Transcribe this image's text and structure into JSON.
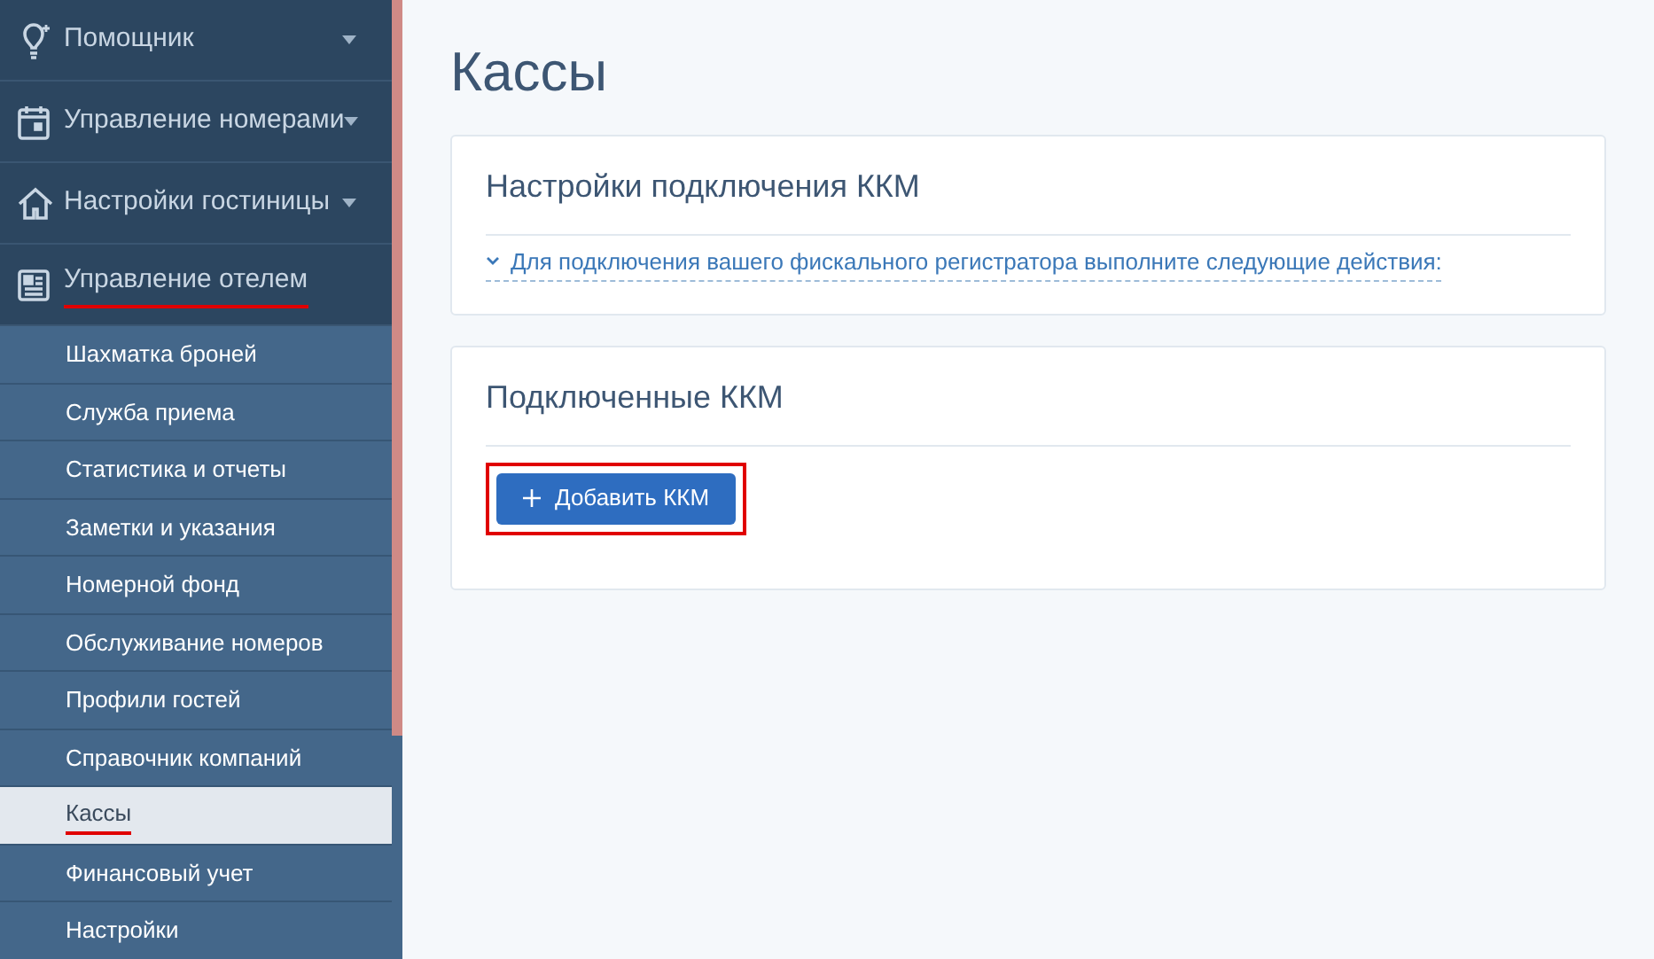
{
  "sidebar": {
    "sections": [
      {
        "label": "Помощник",
        "expanded": false,
        "highlighted": false
      },
      {
        "label": "Управление номерами",
        "expanded": false,
        "highlighted": false
      },
      {
        "label": "Настройки гостиницы",
        "expanded": false,
        "highlighted": false
      },
      {
        "label": "Управление отелем",
        "expanded": true,
        "highlighted": true,
        "children": [
          {
            "label": "Шахматка броней",
            "selected": false,
            "highlighted": false
          },
          {
            "label": "Служба приема",
            "selected": false,
            "highlighted": false
          },
          {
            "label": "Статистика и отчеты",
            "selected": false,
            "highlighted": false
          },
          {
            "label": "Заметки и указания",
            "selected": false,
            "highlighted": false
          },
          {
            "label": "Номерной фонд",
            "selected": false,
            "highlighted": false
          },
          {
            "label": "Обслуживание номеров",
            "selected": false,
            "highlighted": false
          },
          {
            "label": "Профили гостей",
            "selected": false,
            "highlighted": false
          },
          {
            "label": "Справочник компаний",
            "selected": false,
            "highlighted": false
          },
          {
            "label": "Кассы",
            "selected": true,
            "highlighted": true
          },
          {
            "label": "Финансовый учет",
            "selected": false,
            "highlighted": false
          },
          {
            "label": "Настройки",
            "selected": false,
            "highlighted": false
          }
        ]
      }
    ]
  },
  "page_title": "Кассы",
  "cards": [
    {
      "title": "Настройки подключения ККМ",
      "kind": "collapsible",
      "link": "Для подключения вашего фискального регистратора выполните следующие действия:"
    },
    {
      "title": "Подключенные ККМ",
      "kind": "action",
      "button": {
        "label": "Добавить ККМ",
        "highlighted": true
      }
    }
  ]
}
